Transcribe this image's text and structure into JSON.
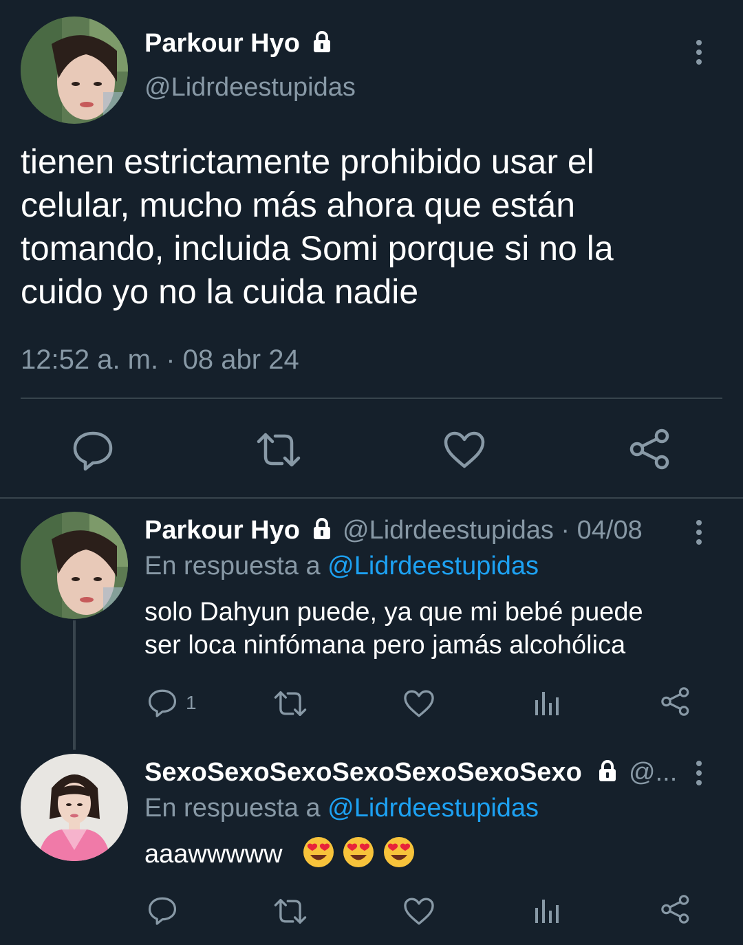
{
  "main_tweet": {
    "author_name": "Parkour Hyo",
    "handle": "@Lidrdeestupidas",
    "text_lines": [
      "tienen estrictamente prohibido usar el",
      "celular, mucho más ahora que están",
      "tomando, incluida Somi porque si no la",
      "cuido yo no la cuida nadie"
    ],
    "timestamp": "12:52 a. m. · 08 abr 24",
    "actions": [
      "reply-icon",
      "retweet-icon",
      "like-icon",
      "share-icon"
    ]
  },
  "reply1": {
    "author_name": "Parkour Hyo",
    "handle_date": "@Lidrdeestupidas · 04/08",
    "replying_prefix": "En respuesta a",
    "replying_to": "@Lidrdeestupidas",
    "text_lines": [
      "solo Dahyun puede, ya que mi bebé puede",
      "ser loca ninfómana pero jamás alcohólica"
    ],
    "reply_count": "1",
    "actions": [
      "reply-icon",
      "retweet-icon",
      "like-icon",
      "analytics-icon",
      "share-icon"
    ]
  },
  "reply2": {
    "author_name": "SexoSexoSexoSexoSexoSexoSexo",
    "handle_truncated": "@...",
    "replying_prefix": "En respuesta a",
    "replying_to": "@Lidrdeestupidas",
    "text": "aaawwwww",
    "emoji": [
      "heart-eyes-emoji",
      "heart-eyes-emoji",
      "heart-eyes-emoji"
    ],
    "actions": [
      "reply-icon",
      "retweet-icon",
      "like-icon",
      "analytics-icon",
      "share-icon"
    ]
  },
  "colors": {
    "background": "#15202b",
    "text": "#ffffff",
    "secondary": "#8899a6",
    "link": "#1da1f2",
    "divider": "#38444d"
  }
}
